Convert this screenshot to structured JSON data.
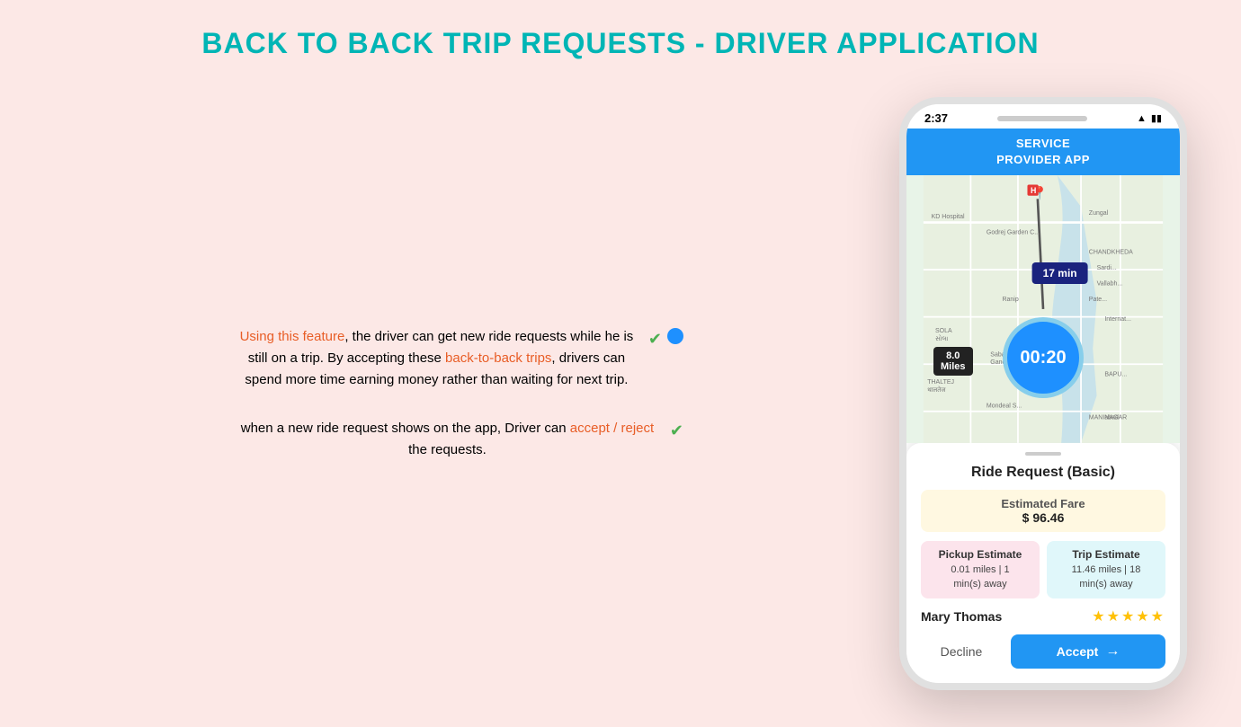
{
  "page": {
    "title": "BACK TO BACK TRIP REQUESTS - DRIVER APPLICATION",
    "background_color": "#fce8e6"
  },
  "left_panel": {
    "text_block_1": "Using this feature, the driver can get new ride requests while he is still on a trip. By accepting these back-to-back trips, drivers can spend more time earning money rather than waiting for next trip.",
    "text_block_2": "when a new ride request shows on the app, Driver can accept / reject the requests."
  },
  "phone": {
    "status_bar": {
      "time": "2:37",
      "wifi_icon": "wifi",
      "battery_icon": "battery"
    },
    "app_header": {
      "title_line1": "SERVICE",
      "title_line2": "PROVIDER APP"
    },
    "map": {
      "time_badge": "17 min",
      "timer": "00:20",
      "distance": "8.0\nMiles"
    },
    "bottom_sheet": {
      "handle": true,
      "ride_request_title": "Ride Request (Basic)",
      "estimated_fare_label": "Estimated Fare",
      "estimated_fare_value": "$ 96.46",
      "pickup_estimate_label": "Pickup Estimate",
      "pickup_estimate_value": "0.01 miles | 1\nmin(s) away",
      "trip_estimate_label": "Trip Estimate",
      "trip_estimate_value": "11.46 miles | 18\nmin(s) away",
      "user_name": "Mary Thomas",
      "stars": "★★★★★",
      "decline_label": "Decline",
      "accept_label": "Accept"
    }
  },
  "connector": {
    "dot_color": "#1e90ff"
  }
}
